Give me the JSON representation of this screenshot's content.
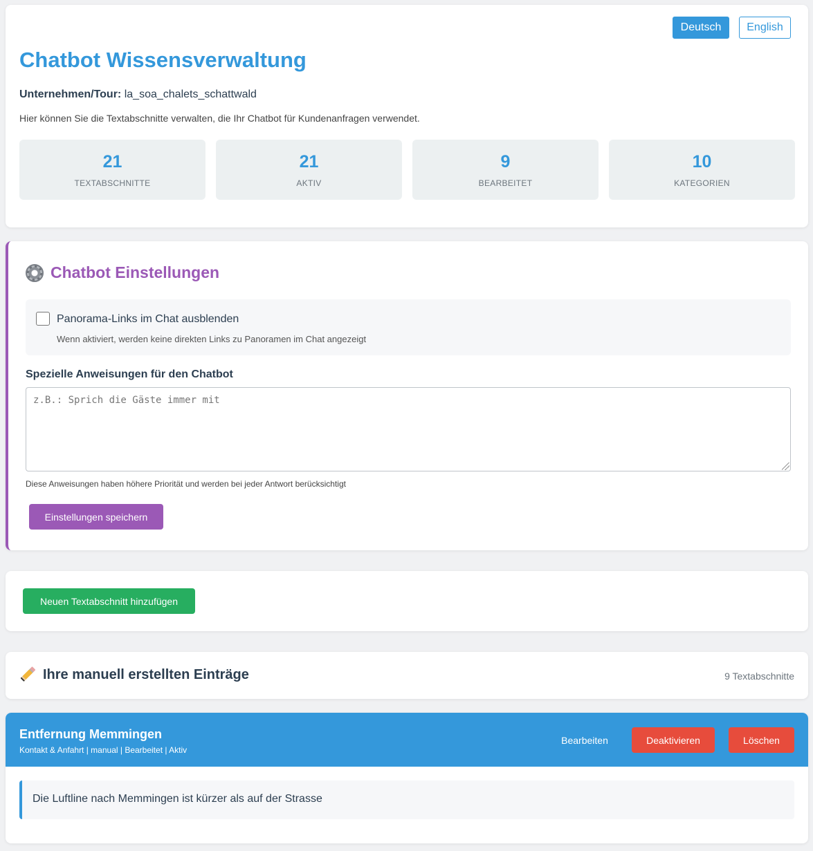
{
  "language": {
    "options": [
      "Deutsch",
      "English"
    ],
    "selected": "Deutsch"
  },
  "header": {
    "title": "Chatbot Wissensverwaltung",
    "company_label": "Unternehmen/Tour:",
    "company_value": "la_soa_chalets_schattwald",
    "description": "Hier können Sie die Textabschnitte verwalten, die Ihr Chatbot für Kundenanfragen verwendet."
  },
  "stats": [
    {
      "value": "21",
      "label": "TEXTABSCHNITTE"
    },
    {
      "value": "21",
      "label": "AKTIV"
    },
    {
      "value": "9",
      "label": "BEARBEITET"
    },
    {
      "value": "10",
      "label": "KATEGORIEN"
    }
  ],
  "settings": {
    "icon": "gear-icon",
    "title": "Chatbot Einstellungen",
    "hide_panorama_label": "Panorama-Links im Chat ausblenden",
    "hide_panorama_checked": false,
    "hide_panorama_hint": "Wenn aktiviert, werden keine direkten Links zu Panoramen im Chat angezeigt",
    "instructions_label": "Spezielle Anweisungen für den Chatbot",
    "instructions_value": "",
    "instructions_placeholder": "z.B.: Sprich die Gäste immer mit",
    "instructions_hint": "Diese Anweisungen haben höhere Priorität und werden bei jeder Antwort berücksichtigt",
    "save_label": "Einstellungen speichern"
  },
  "add": {
    "button_label": "Neuen Textabschnitt hinzufügen"
  },
  "entries": {
    "icon": "pencil-icon",
    "title": "Ihre manuell erstellten Einträge",
    "count_text": "9 Textabschnitte",
    "items": [
      {
        "title": "Entfernung Memmingen",
        "meta": "Kontakt & Anfahrt | manual | Bearbeitet | Aktiv",
        "edit_label": "Bearbeiten",
        "deactivate_label": "Deaktivieren",
        "delete_label": "Löschen",
        "text": "Die Luftline nach Memmingen ist kürzer als auf der Strasse"
      }
    ]
  },
  "colors": {
    "primary": "#3498db",
    "settings_accent": "#9b59b6",
    "add_button": "#27ae60",
    "danger": "#e74c3c",
    "stat_bg": "#ecf0f1"
  }
}
